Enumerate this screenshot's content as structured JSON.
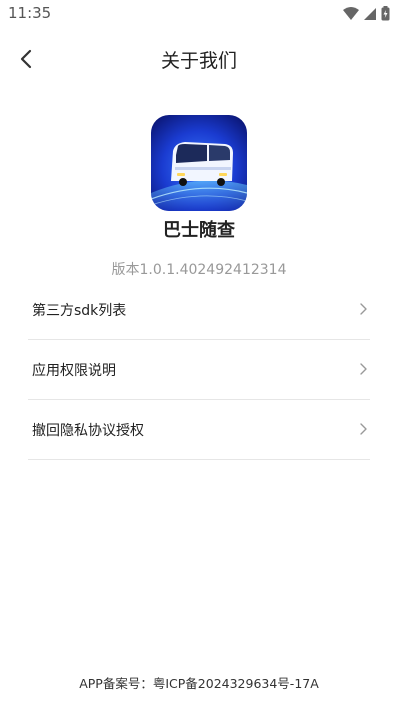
{
  "status_bar": {
    "time": "11:35",
    "icons": [
      "wifi-icon",
      "signal-icon",
      "battery-icon"
    ]
  },
  "header": {
    "title": "关于我们",
    "back_icon": "back-arrow-icon"
  },
  "app": {
    "name": "巴士随查",
    "version": "版本1.0.1.402492412314",
    "logo": "bus-logo"
  },
  "menu": {
    "items": [
      {
        "label": "第三方sdk列表"
      },
      {
        "label": "应用权限说明"
      },
      {
        "label": "撤回隐私协议授权"
      }
    ]
  },
  "footer": {
    "icp": "APP备案号：粤ICP备2024329634号-17A"
  },
  "colors": {
    "text": "#222222",
    "muted": "#999999",
    "divider": "#e6e6e6",
    "logo_blue": "#1a3bd0"
  }
}
